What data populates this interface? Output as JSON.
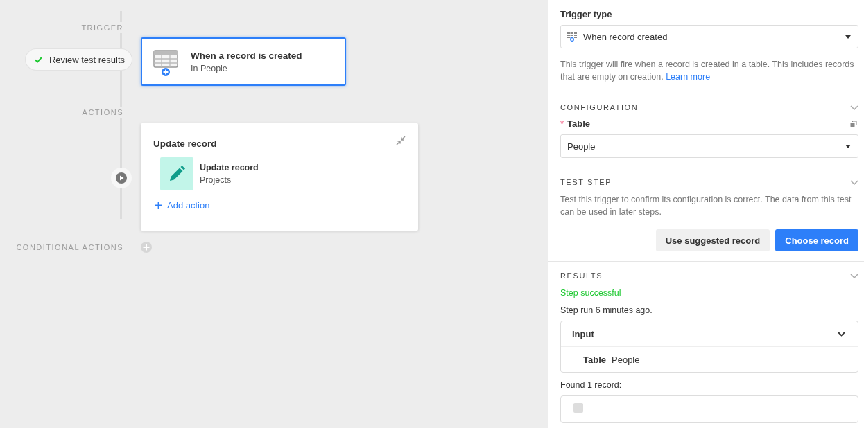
{
  "canvas": {
    "trigger_label": "TRIGGER",
    "review_button": {
      "label": "Review test results"
    },
    "trigger_card": {
      "title": "When a record is created",
      "subtitle": "In People",
      "selected": true
    },
    "actions_label": "ACTIONS",
    "action_card": {
      "title": "Update record",
      "step": {
        "title": "Update record",
        "subtitle": "Projects"
      },
      "add_action": "Add action"
    },
    "conditional_label": "CONDITIONAL ACTIONS"
  },
  "panel": {
    "trigger_type": {
      "label": "Trigger type",
      "value": "When record created"
    },
    "description": "This trigger will fire when a record is created in a table. This includes records that are empty on creation.",
    "learn_more": "Learn more",
    "configuration": {
      "heading": "CONFIGURATION",
      "required_mark": "*",
      "field_label": "Table",
      "value": "People"
    },
    "test_step": {
      "heading": "TEST STEP",
      "description": "Test this trigger to confirm its configuration is correct. The data from this test can be used in later steps.",
      "buttons": [
        {
          "label": "Use suggested record",
          "kind": "secondary"
        },
        {
          "label": "Choose record",
          "kind": "primary"
        }
      ]
    },
    "results": {
      "heading": "RESULTS",
      "status": "Step successful",
      "run_time": "Step run 6 minutes ago.",
      "input": {
        "title": "Input",
        "rows": [
          {
            "key": "Table",
            "value": "People"
          }
        ]
      },
      "found": "Found 1 record:"
    }
  }
}
